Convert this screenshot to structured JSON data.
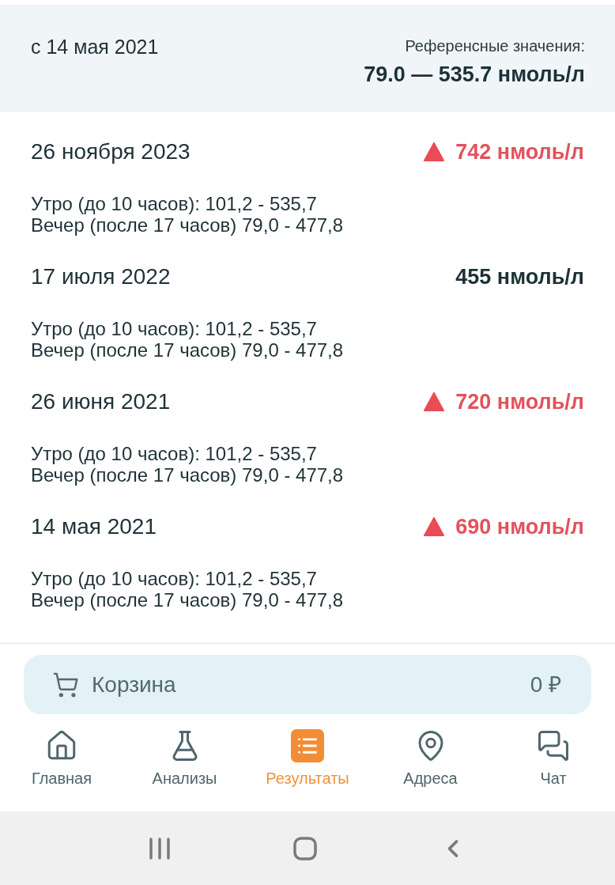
{
  "header": {
    "since": "с 14 мая 2021",
    "reference_label": "Референсные значения:",
    "reference_value": "79.0 — 535.7 нмоль/л"
  },
  "results": [
    {
      "date": "26 ноября 2023",
      "value": "742 нмоль/л",
      "high": true,
      "notes": [
        "Утро (до 10 часов): 101,2 - 535,7",
        "Вечер (после 17 часов) 79,0 - 477,8"
      ]
    },
    {
      "date": "17 июля 2022",
      "value": "455 нмоль/л",
      "high": false,
      "notes": [
        "Утро (до 10 часов): 101,2 - 535,7",
        "Вечер (после 17 часов) 79,0 - 477,8"
      ]
    },
    {
      "date": "26 июня 2021",
      "value": "720 нмоль/л",
      "high": true,
      "notes": [
        "Утро (до 10 часов): 101,2 - 535,7",
        "Вечер (после 17 часов) 79,0 - 477,8"
      ]
    },
    {
      "date": "14 мая 2021",
      "value": "690 нмоль/л",
      "high": true,
      "notes": [
        "Утро (до 10 часов): 101,2 - 535,7",
        "Вечер (после 17 часов) 79,0 - 477,8"
      ]
    }
  ],
  "cart": {
    "label": "Корзина",
    "total": "0 ₽"
  },
  "nav": [
    {
      "kind": "home",
      "label": "Главная",
      "selected": false
    },
    {
      "kind": "tests",
      "label": "Анализы",
      "selected": false
    },
    {
      "kind": "results",
      "label": "Результаты",
      "selected": true
    },
    {
      "kind": "addresses",
      "label": "Адреса",
      "selected": false
    },
    {
      "kind": "chat",
      "label": "Чат",
      "selected": false
    }
  ]
}
